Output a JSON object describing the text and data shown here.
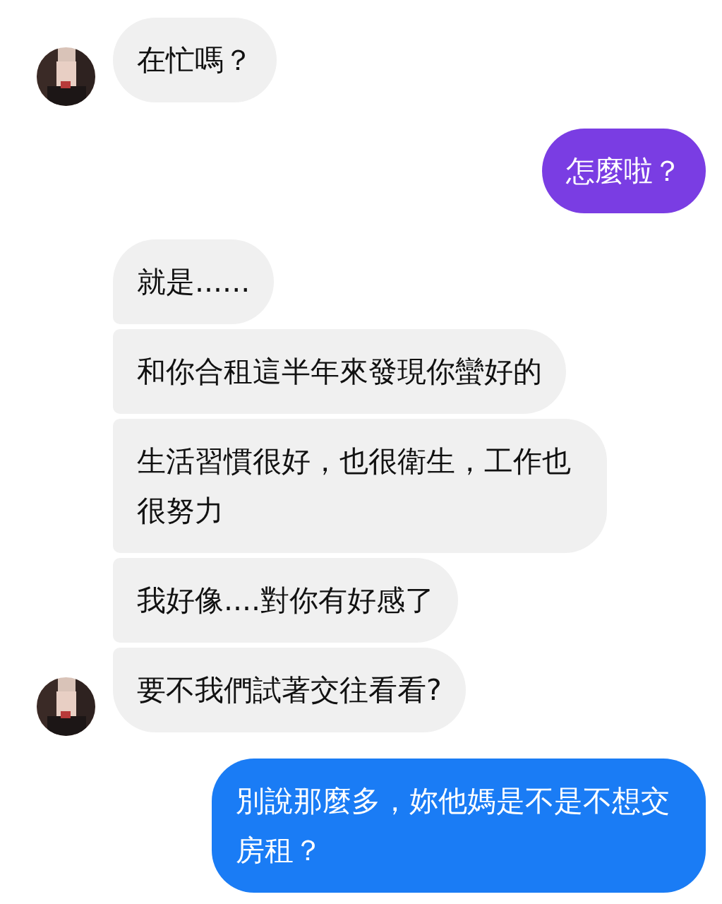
{
  "messages": [
    {
      "kind": "incoming",
      "text": "在忙嗎？",
      "show_avatar": true,
      "color": "#f0f0f0"
    },
    {
      "kind": "outgoing",
      "text": "怎麼啦？",
      "color": "#7a3de3"
    },
    {
      "kind": "incoming",
      "text": "就是......",
      "show_avatar": false,
      "color": "#f0f0f0"
    },
    {
      "kind": "incoming",
      "text": "和你合租這半年來發現你蠻好的",
      "show_avatar": false,
      "color": "#f0f0f0"
    },
    {
      "kind": "incoming",
      "text": "生活習慣很好，也很衛生，工作也很努力",
      "show_avatar": false,
      "color": "#f0f0f0"
    },
    {
      "kind": "incoming",
      "text": "我好像....對你有好感了",
      "show_avatar": false,
      "color": "#f0f0f0"
    },
    {
      "kind": "incoming",
      "text": "要不我們試著交往看看?",
      "show_avatar": true,
      "color": "#f0f0f0"
    },
    {
      "kind": "outgoing",
      "text": "別說那麼多，妳他媽是不是不想交房租？",
      "color": "#1a7cf5"
    }
  ]
}
